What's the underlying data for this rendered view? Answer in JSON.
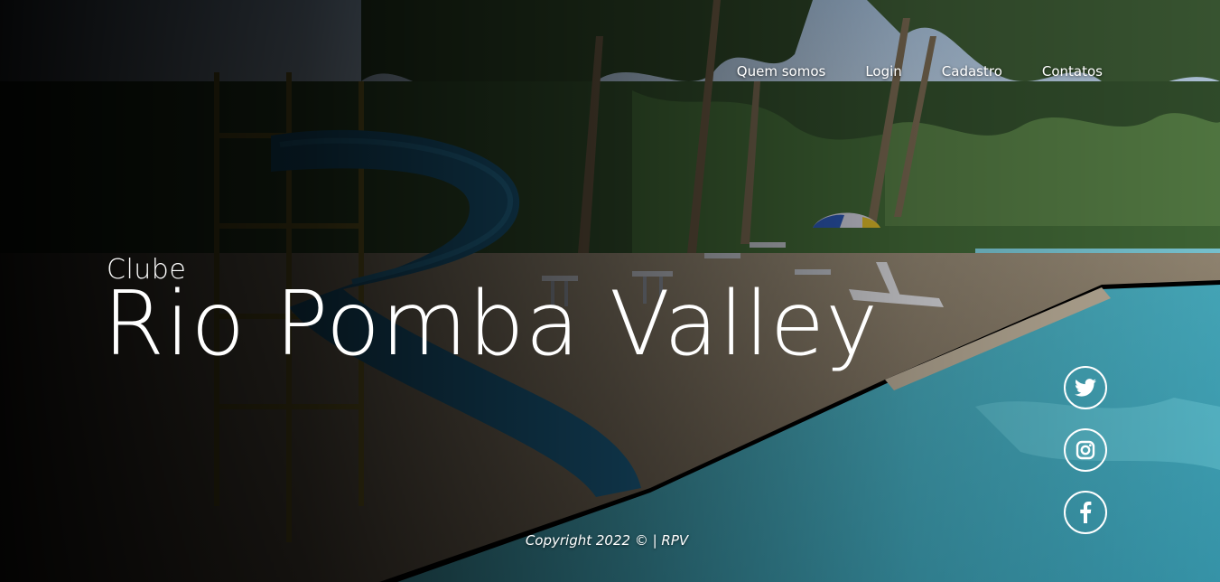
{
  "nav": {
    "items": [
      {
        "label": "Quem somos",
        "icon": null
      },
      {
        "label": "Login",
        "icon": null
      },
      {
        "label": "Cadastro",
        "icon": null
      },
      {
        "label": "Contatos",
        "icon": null
      }
    ]
  },
  "hero": {
    "subtitle": "Clube",
    "title": "Rio Pomba Valley",
    "background": "club-pool-photo"
  },
  "social": [
    {
      "icon": "twitter-icon"
    },
    {
      "icon": "instagram-icon"
    },
    {
      "icon": "facebook-icon"
    }
  ],
  "footer": {
    "copyright": "Copyright 2022 © | RPV"
  },
  "colors": {
    "text": "#ffffff",
    "pool": "#4fb8c9",
    "sky": "#b7cfe6",
    "foliage": "#2f4a2a",
    "slide": "#1d5f86"
  }
}
